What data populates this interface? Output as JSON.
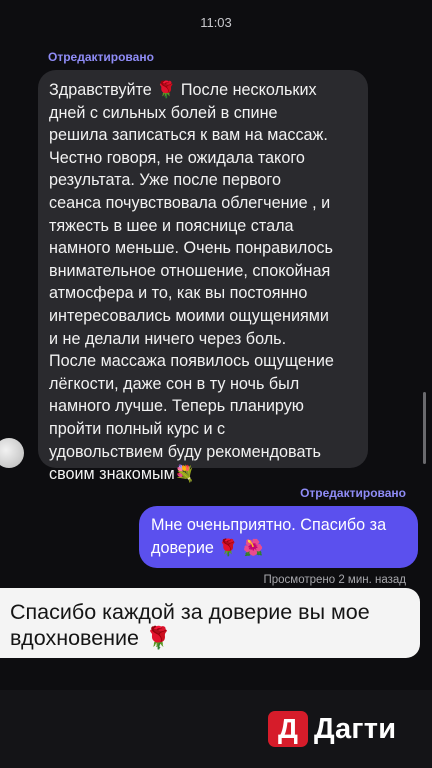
{
  "status_bar": {
    "time": "11:03"
  },
  "incoming": {
    "edited_label": "Отредактировано",
    "lines": [
      "Здравствуйте 🌹 После нескольких",
      "дней с сильных болей в спине",
      "решила записаться к вам на массаж.",
      "Честно говоря, не ожидала такого",
      "результата. Уже после первого",
      "сеанса почувствовала облегчение , и",
      "тяжесть в шее и пояснице стала",
      "намного меньше. Очень понравилось",
      "внимательное отношение, спокойная",
      "атмосфера и то, как вы постоянно",
      "интересовались моими ощущениями",
      "и не делали ничего через боль.",
      "После массажа появилось ощущение",
      "лёгкости, даже сон в ту ночь был",
      "намного лучше. Теперь планирую",
      "пройти полный курс и с",
      "удовольствием буду рекомендовать",
      "своим знакомым💐"
    ]
  },
  "outgoing": {
    "edited_label": "Отредактировано",
    "lines": [
      "Мне оченьприятно. Спасибо за",
      "доверие 🌹 🌺"
    ],
    "seen_status": "Просмотрено 2 мин. назад"
  },
  "caption": {
    "lines": [
      "Спасибо каждой за доверие вы мое",
      "вдохновение 🌹"
    ]
  },
  "watermark": {
    "mark": "Д",
    "text": "Дагти"
  },
  "colors": {
    "background": "#0d0d10",
    "incoming_bubble": "#2a2a2e",
    "outgoing_bubble": "#5b50ee",
    "edited_label": "#8f8cf6",
    "logo_red": "#d61c2a"
  }
}
